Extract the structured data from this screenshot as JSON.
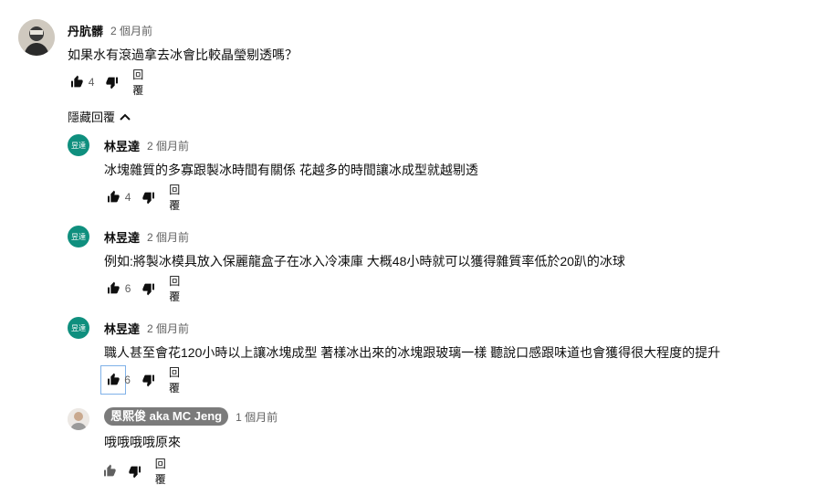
{
  "top_comment": {
    "author": "丹肮髒",
    "time": "2 個月前",
    "text": "如果水有滾過拿去冰會比較晶瑩剔透嗎？",
    "likes": "4",
    "reply_label": "回覆"
  },
  "hide_replies_label": "隱藏回覆",
  "replies": [
    {
      "avatar_text": "昱達",
      "author": "林昱達",
      "time": "2 個月前",
      "text": "冰塊雜質的多寡跟製冰時間有關係 花越多的時間讓冰成型就越剔透",
      "likes": "4",
      "reply_label": "回覆"
    },
    {
      "avatar_text": "昱達",
      "author": "林昱達",
      "time": "2 個月前",
      "text": "例如:將製冰模具放入保麗龍盒子在冰入冷凍庫 大概48小時就可以獲得雜質率低於20趴的冰球",
      "likes": "6",
      "reply_label": "回覆"
    },
    {
      "avatar_text": "昱達",
      "author": "林昱達",
      "time": "2 個月前",
      "text": "職人甚至會花120小時以上讓冰塊成型 著樣冰出來的冰塊跟玻璃一樣 聽說口感跟味道也會獲得很大程度的提升",
      "likes": "6",
      "reply_label": "回覆"
    },
    {
      "author": "恩熙俊 aka MC Jeng",
      "time": "1 個月前",
      "text": "哦哦哦哦原來",
      "likes": "",
      "reply_label": "回覆"
    }
  ],
  "colors": {
    "teal_avatar": "#0f8f7e",
    "chip_bg": "#7b7b7b",
    "icon": "#0f0f0f",
    "muted": "#606060"
  }
}
